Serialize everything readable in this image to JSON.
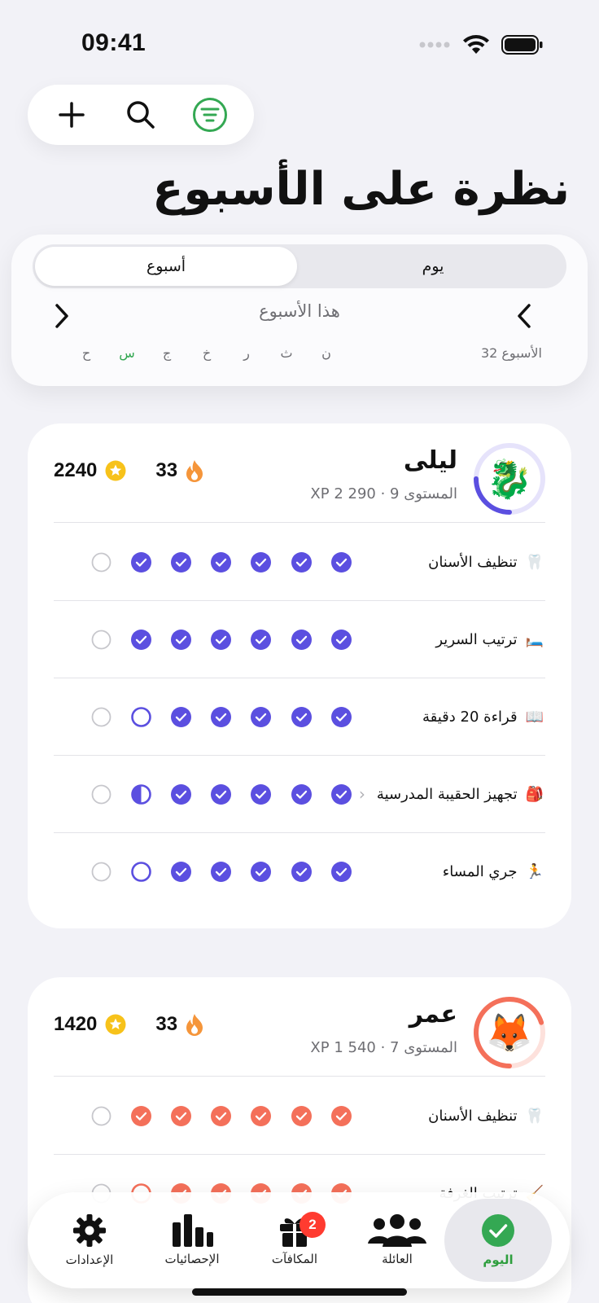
{
  "status_bar": {
    "time": "09:41"
  },
  "page_title": "نظرة على الأسبوع",
  "segmented": {
    "week": "أسبوع",
    "day": "يوم"
  },
  "week_nav": {
    "label": "هذا الأسبوع",
    "week_number": "الأسبوع 32"
  },
  "days": [
    "ح",
    "س",
    "ج",
    "خ",
    "ر",
    "ث",
    "ن"
  ],
  "active_day_index": 1,
  "children": [
    {
      "name": "ليلى",
      "meta": "المستوى 9 · 290 2 XP",
      "streak": "33",
      "points": "2240",
      "avatar_emoji": "🐉",
      "ring_color": "#5b4fe0",
      "ring_track": "#e6e3fb",
      "ring_progress": 0.25,
      "accent": "#5b4fe0",
      "tasks": [
        {
          "emoji": "🦷",
          "label": "تنظيف الأسنان",
          "chevron": "",
          "status": [
            "empty",
            "done",
            "done",
            "done",
            "done",
            "done",
            "done"
          ]
        },
        {
          "emoji": "🛏️",
          "label": "ترتيب السرير",
          "chevron": "",
          "status": [
            "empty",
            "done",
            "done",
            "done",
            "done",
            "done",
            "done"
          ]
        },
        {
          "emoji": "📖",
          "label": "قراءة 20 دقيقة",
          "chevron": "",
          "status": [
            "empty",
            "ring",
            "done",
            "done",
            "done",
            "done",
            "done"
          ]
        },
        {
          "emoji": "🎒",
          "label": "تجهيز الحقيبة المدرسية",
          "chevron": "‹",
          "status": [
            "empty",
            "half",
            "done",
            "done",
            "done",
            "done",
            "done"
          ]
        },
        {
          "emoji": "🏃",
          "label": "جري المساء",
          "chevron": "",
          "status": [
            "empty",
            "ring",
            "done",
            "done",
            "done",
            "done",
            "done"
          ]
        }
      ]
    },
    {
      "name": "عمر",
      "meta": "المستوى 7 · 540 1 XP",
      "streak": "33",
      "points": "1420",
      "avatar_emoji": "🦊",
      "ring_color": "#f4705a",
      "ring_track": "#fde1dc",
      "ring_progress": 0.7,
      "accent": "#f4705a",
      "tasks": [
        {
          "emoji": "🦷",
          "label": "تنظيف الأسنان",
          "chevron": "",
          "status": [
            "empty",
            "done",
            "done",
            "done",
            "done",
            "done",
            "done"
          ]
        },
        {
          "emoji": "🧹",
          "label": "ترتيب الغرفة",
          "chevron": "",
          "status": [
            "empty",
            "ring",
            "done",
            "done",
            "done",
            "done",
            "done"
          ]
        }
      ]
    }
  ],
  "tabs": [
    {
      "label": "الإعدادات",
      "icon": "gear-icon"
    },
    {
      "label": "الإحصائيات",
      "icon": "bar-chart-icon"
    },
    {
      "label": "المكافآت",
      "icon": "gift-icon",
      "badge": "2"
    },
    {
      "label": "العائلة",
      "icon": "family-icon"
    },
    {
      "label": "اليوم",
      "icon": "check-circle-icon",
      "active": true
    }
  ],
  "colors": {
    "green": "#34a853",
    "purple": "#5b4fe0",
    "coral": "#f4705a",
    "star": "#f7c21a",
    "flame": "#f5953a"
  }
}
